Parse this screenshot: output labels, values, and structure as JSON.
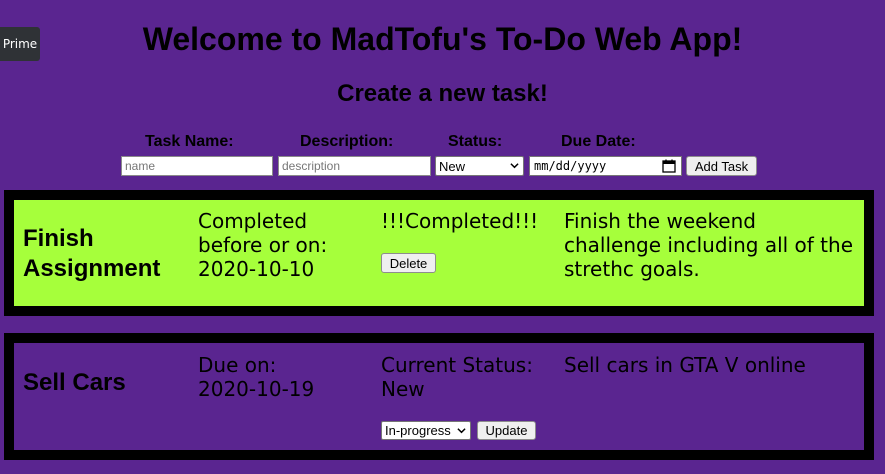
{
  "prime_button": {
    "label": "Prime"
  },
  "header": {
    "title": "Welcome to MadTofu's To-Do Web App!",
    "subtitle": "Create a new task!"
  },
  "form": {
    "task_name_label": "Task Name:",
    "description_label": "Description:",
    "status_label": "Status:",
    "due_date_label": "Due Date:",
    "name_placeholder": "name",
    "description_placeholder": "description",
    "status_value": "New",
    "date_placeholder": "mm/dd/yyyy",
    "add_button": "Add Task"
  },
  "tasks": [
    {
      "title": "Finish Assignment",
      "due_label": "Completed before or on:",
      "due_date": "2020-10-10",
      "status_text": "!!!Completed!!!",
      "action_button": "Delete",
      "description": "Finish the weekend challenge including all of the strethc goals.",
      "background": "#a6ff3b"
    },
    {
      "title": "Sell Cars",
      "due_label": "Due on:",
      "due_date": "2020-10-19",
      "status_text": "Current Status: New",
      "status_select_value": "In-progress",
      "action_button": "Update",
      "description": "Sell cars in GTA V online",
      "background": "#5a2590"
    }
  ],
  "colors": {
    "page_background": "#5a2590",
    "card_border": "#000000",
    "completed_card": "#a6ff3b"
  }
}
